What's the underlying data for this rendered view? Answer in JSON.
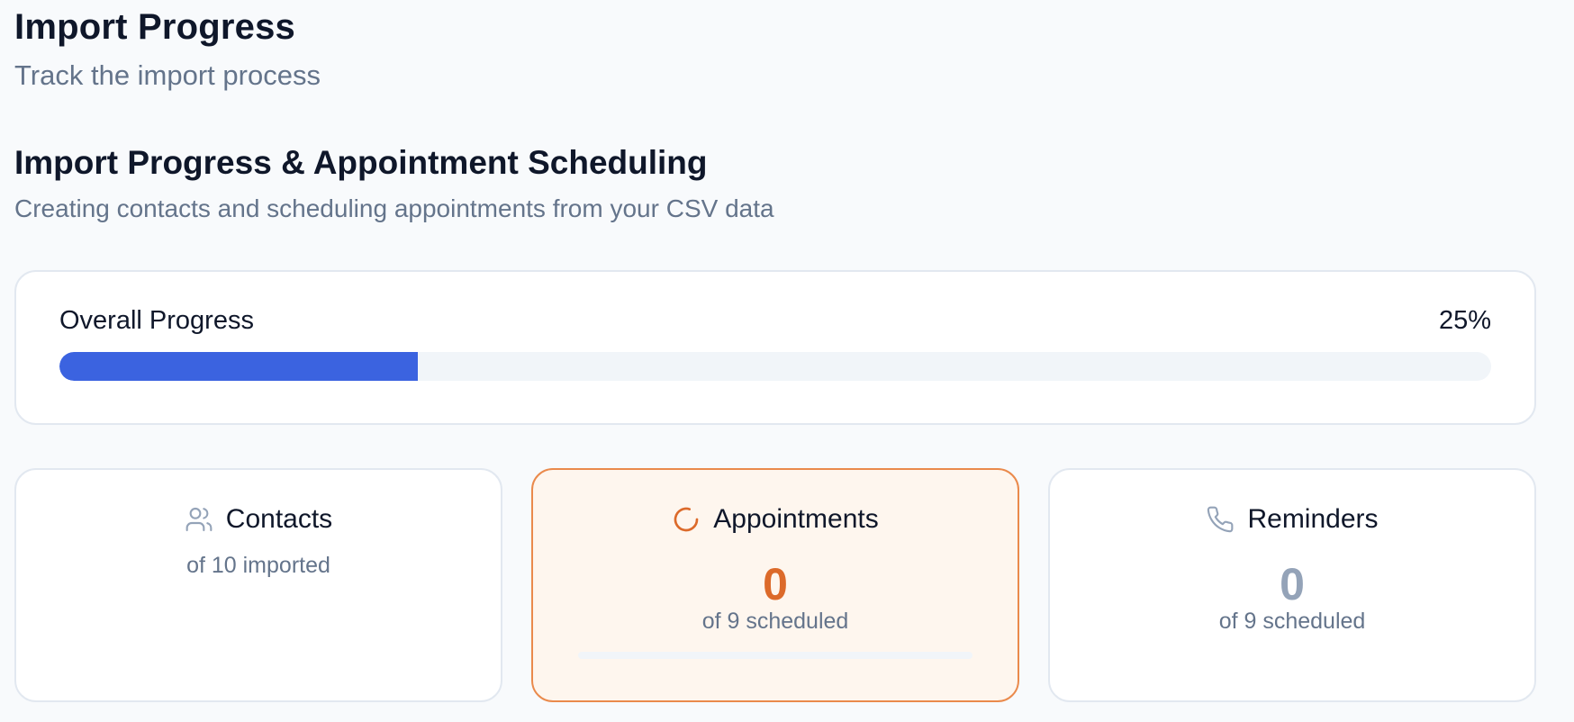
{
  "header": {
    "title": "Import Progress",
    "subtitle": "Track the import process"
  },
  "section": {
    "title": "Import Progress & Appointment Scheduling",
    "subtitle": "Creating contacts and scheduling appointments from your CSV data"
  },
  "overall": {
    "label": "Overall Progress",
    "percent_text": "25%",
    "progress_fraction": 0.25,
    "fill_color": "#3b63e0"
  },
  "stats": {
    "contacts": {
      "title": "Contacts",
      "icon": "users-icon",
      "subtitle": "of 10 imported"
    },
    "appointments": {
      "title": "Appointments",
      "icon": "loading-spinner-icon",
      "count": "0",
      "subtitle": "of 9 scheduled",
      "progress_fraction": 0,
      "accent_color": "#dc6a2a",
      "background_color": "#fef6ee",
      "border_color": "#ea8a4c"
    },
    "reminders": {
      "title": "Reminders",
      "icon": "phone-icon",
      "count": "0",
      "subtitle": "of 9 scheduled"
    }
  }
}
